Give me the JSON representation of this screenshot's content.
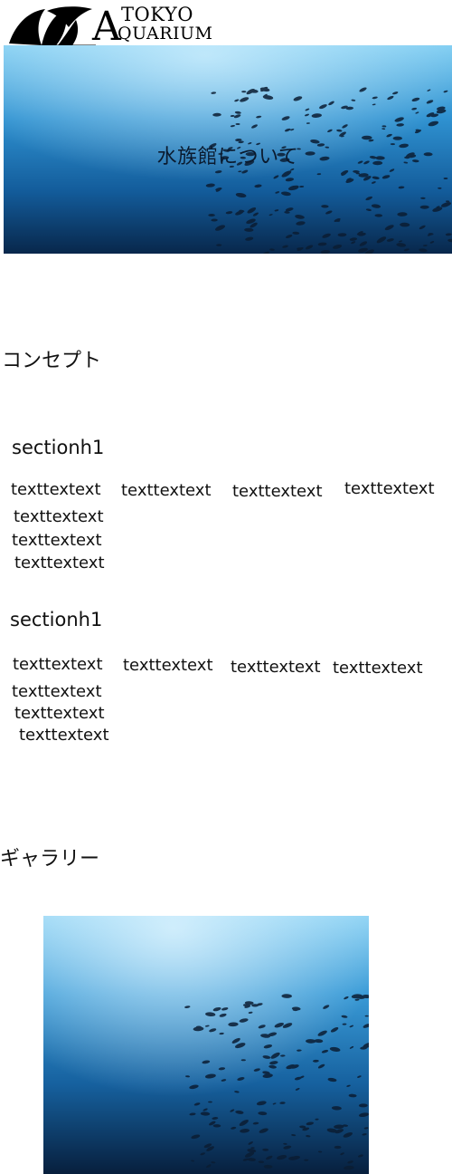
{
  "header": {
    "logo": {
      "tokyo": "TOKYO",
      "a": "A",
      "quarium": "QUARIUM"
    }
  },
  "hero": {
    "title": "水族館について"
  },
  "concept": {
    "heading": "コンセプト",
    "sections": [
      {
        "heading": "sectionh1",
        "texts": [
          "texttextext",
          "texttextext",
          "texttextext",
          "texttextext",
          "texttextext",
          "texttextext",
          "texttextext"
        ]
      },
      {
        "heading": "sectionh1",
        "texts": [
          "texttextext",
          "texttextext",
          "texttextext",
          "texttextext",
          "texttextext",
          "texttextext",
          "texttextext"
        ]
      }
    ]
  },
  "gallery": {
    "heading": "ギャラリー"
  },
  "colors": {
    "water_top": "#6ec3ee",
    "water_mid": "#1f7dbf",
    "water_deep": "#0a2f5a",
    "fish": "#0b1d33"
  },
  "icons": {
    "logo_mark": "angelfish-logo-icon"
  }
}
